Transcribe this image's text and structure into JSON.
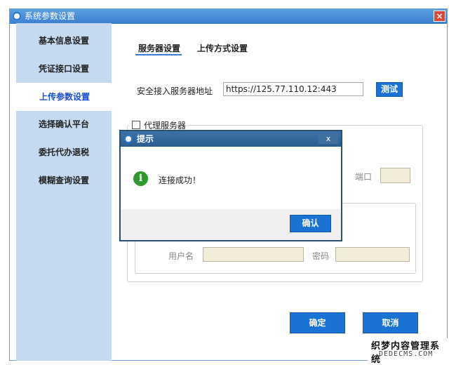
{
  "window": {
    "title": "系统参数设置",
    "close_label": "×"
  },
  "sidebar": {
    "items": [
      {
        "label": "基本信息设置",
        "active": false
      },
      {
        "label": "凭证接口设置",
        "active": false
      },
      {
        "label": "上传参数设置",
        "active": true
      },
      {
        "label": "选择确认平台",
        "active": false
      },
      {
        "label": "委托代办退税",
        "active": false
      },
      {
        "label": "模糊查询设置",
        "active": false
      }
    ]
  },
  "tabs": [
    {
      "label": "服务器设置",
      "active": true
    },
    {
      "label": "上传方式设置",
      "active": false
    }
  ],
  "server": {
    "address_label": "安全接入服务器地址",
    "address_value": "https://125.77.110.12:443",
    "test_button": "测试"
  },
  "proxy": {
    "checkbox_label": "代理服务器",
    "port_label": "端口",
    "username_label": "用户名",
    "password_label": "密码"
  },
  "footer": {
    "ok_label": "确定",
    "cancel_label": "取消"
  },
  "modal": {
    "title": "提示",
    "close_label": "x",
    "message": "连接成功！",
    "ok_label": "确认"
  },
  "watermark": {
    "line1": "织梦内容管理系统",
    "line2": "DEDECMS.COM"
  },
  "colors": {
    "accent": "#1a72d2",
    "sidebar": "#c5daf0",
    "active_text": "#1a4fd8",
    "success_icon": "#2e9a2e"
  },
  "icons": {
    "app": "app-logo-icon",
    "info": "info-icon"
  }
}
